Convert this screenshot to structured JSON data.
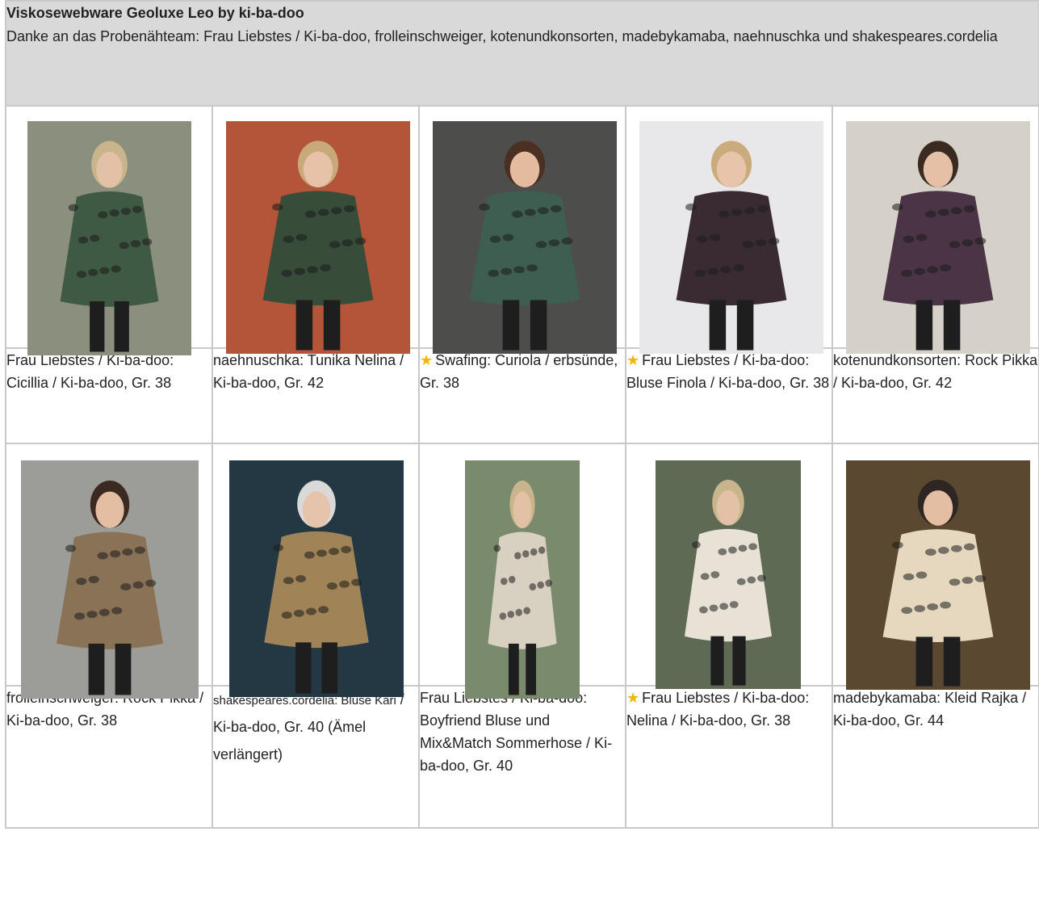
{
  "header": {
    "title": "Viskosewebware Geoluxe Leo by ki-ba-doo",
    "subtitle": "Danke an das Probenähteam: Frau Liebstes / Ki-ba-doo, frolleinschweiger, kotenundkonsorten, madebykamaba, naehnuschka und shakespeares.cordelia"
  },
  "row1": [
    {
      "caption": "Frau Liebstes / Ki-ba-doo: Cicillia / Ki-ba-doo, Gr. 38",
      "star": false,
      "photo_colors": {
        "bg": "#8a8f7e",
        "garment": "#3f5a44",
        "skin": "#e3c1a6",
        "hair": "#c8b58c"
      }
    },
    {
      "caption": "naehnuschka: Tunika Nelina / Ki-ba-doo, Gr. 42",
      "star": false,
      "photo_colors": {
        "bg": "#b4553a",
        "garment": "#384c3a",
        "skin": "#e8c2a8",
        "hair": "#c8a97a"
      }
    },
    {
      "caption": "Swafing: Curiola / erbsünde, Gr. 38",
      "star": true,
      "photo_colors": {
        "bg": "#4d4e4c",
        "garment": "#3e5e52",
        "skin": "#e5bba0",
        "hair": "#4a2f22"
      }
    },
    {
      "caption": "Frau Liebstes / Ki-ba-doo: Bluse Finola / Ki-ba-doo, Gr. 38",
      "star": true,
      "photo_colors": {
        "bg": "#e8e8ea",
        "garment": "#3a2b33",
        "skin": "#e8c4ab",
        "hair": "#c9ab7c"
      }
    },
    {
      "caption": "kotenundkonsorten: Rock Pikka / Ki-ba-doo, Gr. 42",
      "star": false,
      "photo_colors": {
        "bg": "#d5d1c8",
        "garment": "#4a3445",
        "skin": "#e5c0a7",
        "hair": "#3a2a22"
      }
    }
  ],
  "row2": [
    {
      "caption": "frolleinschweiger: Rock Pikka / Ki-ba-doo, Gr. 38",
      "star": false,
      "photo_colors": {
        "bg": "#9c9d98",
        "garment": "#8a7256",
        "skin": "#e3bea3",
        "hair": "#3a2a22"
      }
    },
    {
      "caption_prefix": "shakespeares.cordelia: Bluse Kari",
      "caption": " / Ki-ba-doo, Gr. 40 (Ämel verlängert)",
      "star": false,
      "photo_colors": {
        "bg": "#243844",
        "garment": "#a08356",
        "skin": "#e6c4ac",
        "hair": "#d9d9d9"
      }
    },
    {
      "caption": "Frau Liebstes / Ki-ba-doo: Boyfriend Bluse und Mix&Match Sommerhose / Ki-ba-doo, Gr. 40",
      "star": false,
      "photo_colors": {
        "bg": "#7a8a6c",
        "garment": "#d8d0c0",
        "skin": "#e3c1a6",
        "hair": "#c8b58c"
      }
    },
    {
      "caption": "Frau Liebstes / Ki-ba-doo: Nelina / Ki-ba-doo, Gr. 38",
      "star": true,
      "photo_colors": {
        "bg": "#5f6a55",
        "garment": "#e8e2d6",
        "skin": "#e3c1a6",
        "hair": "#c8b58c"
      }
    },
    {
      "caption": "madebykamaba: Kleid Rajka / Ki-ba-doo, Gr. 44",
      "star": false,
      "photo_colors": {
        "bg": "#5a4830",
        "garment": "#e6d8be",
        "skin": "#e3bea3",
        "hair": "#2e2622"
      }
    }
  ]
}
